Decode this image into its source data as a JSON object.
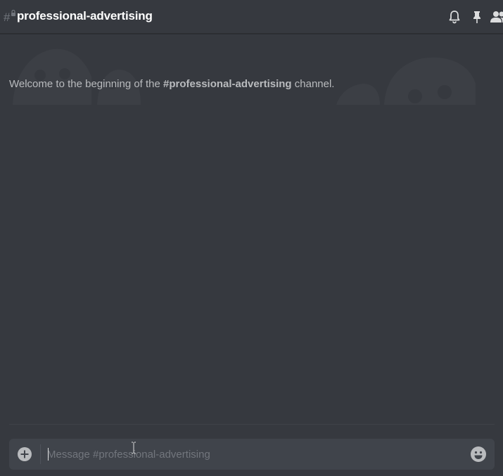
{
  "header": {
    "channel_name": "professional-advertising",
    "channel_icon": "locked-hash-icon",
    "actions": [
      {
        "name": "notifications",
        "icon": "bell-icon"
      },
      {
        "name": "pinned-messages",
        "icon": "pin-icon"
      },
      {
        "name": "member-list",
        "icon": "members-icon"
      }
    ]
  },
  "messages": {
    "welcome_prefix": "Welcome to the beginning of the ",
    "welcome_channel": "#professional-advertising",
    "welcome_suffix": " channel."
  },
  "composer": {
    "placeholder": "Message #professional-advertising",
    "value": "",
    "upload_icon": "plus-circle-icon",
    "emoji_icon": "smiley-icon"
  },
  "colors": {
    "background": "#36393f",
    "composer_background": "#40444b",
    "header_text": "#ffffff",
    "muted_text": "#b9bbbe",
    "icon_gray": "#b9bbbe"
  }
}
